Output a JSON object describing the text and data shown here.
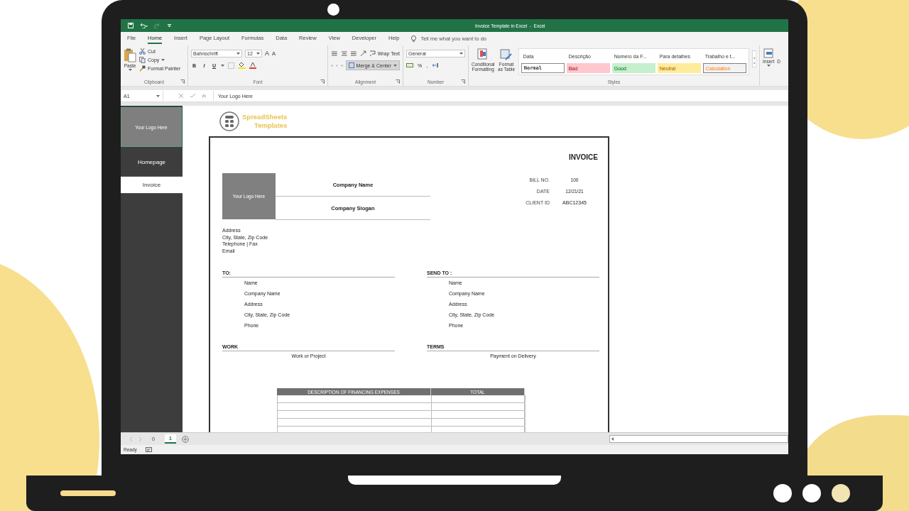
{
  "window": {
    "title": "Invoice Template in Excel  -  Excel"
  },
  "ribbon_tabs": [
    {
      "label": "File",
      "selected": false
    },
    {
      "label": "Home",
      "selected": true
    },
    {
      "label": "Insert",
      "selected": false
    },
    {
      "label": "Page Layout",
      "selected": false
    },
    {
      "label": "Formulas",
      "selected": false
    },
    {
      "label": "Data",
      "selected": false
    },
    {
      "label": "Review",
      "selected": false
    },
    {
      "label": "View",
      "selected": false
    },
    {
      "label": "Developer",
      "selected": false
    },
    {
      "label": "Help",
      "selected": false
    }
  ],
  "tell_me": {
    "placeholder": "Tell me what you want to do"
  },
  "ribbon": {
    "clipboard": {
      "label": "Clipboard",
      "paste": "Paste",
      "cut": "Cut",
      "copy": "Copy",
      "format_painter": "Format Painter"
    },
    "font": {
      "label": "Font",
      "font_name": "Bahnschrift",
      "font_size": "12",
      "size_buttons": [
        "A",
        "A"
      ],
      "style_buttons": [
        "B",
        "I",
        "U"
      ]
    },
    "alignment": {
      "label": "Alignment",
      "wrap_text": "Wrap Text",
      "merge_center": "Merge & Center"
    },
    "number": {
      "label": "Number",
      "format": "General",
      "symbols": [
        "%",
        ","
      ]
    },
    "styles": {
      "label": "Styles",
      "conditional_formatting": "Conditional Formatting",
      "format_as_table": "Format as Table",
      "gallery": [
        {
          "label": "Data",
          "kind": "heading"
        },
        {
          "label": "Descrição",
          "kind": "heading"
        },
        {
          "label": "Número da F...",
          "kind": "heading"
        },
        {
          "label": "Para detalhes",
          "kind": "heading"
        },
        {
          "label": "Trabalho e t...",
          "kind": "heading"
        },
        {
          "label": "Normal",
          "kind": "normal"
        },
        {
          "label": "Bad",
          "kind": "bad"
        },
        {
          "label": "Good",
          "kind": "good"
        },
        {
          "label": "Neutral",
          "kind": "neutral"
        },
        {
          "label": "Calculation",
          "kind": "calculation"
        }
      ]
    },
    "cells": {
      "insert": "Insert",
      "next": "D"
    }
  },
  "formula_bar": {
    "name_box": "A1",
    "function_label": "fx",
    "value": "Your Logo Here"
  },
  "sidebar": {
    "logo": "Your Logo Here",
    "items": [
      {
        "label": "Homepage",
        "selected": false
      },
      {
        "label": "Invoice",
        "selected": true
      }
    ]
  },
  "brand": {
    "line1": "SpreadSheets",
    "line2": "Templates"
  },
  "invoice": {
    "title": "INVOICE",
    "logo": "Your Logo Here",
    "company_name": "Company Name",
    "company_slogan": "Company Slogan",
    "details": [
      {
        "label": "BILL NO.",
        "value": "100"
      },
      {
        "label": "DATE",
        "value": "12/21/21"
      },
      {
        "label": "CLIENT ID",
        "value": "ABC12345"
      }
    ],
    "sender_lines": [
      "Address",
      "City, State, Zip Code",
      "Telephone | Fax",
      "Email"
    ],
    "to": {
      "heading": "TO:",
      "lines": [
        "Name",
        "Company Name",
        "Address",
        "City, State, Zip Code",
        "Phone"
      ]
    },
    "send_to": {
      "heading": "SEND TO :",
      "lines": [
        "Name",
        "Company Name",
        "Address",
        "City, State, Zip Code",
        "Phone"
      ]
    },
    "work": {
      "heading": "WORK",
      "value": "Work or Project"
    },
    "terms": {
      "heading": "TERMS",
      "value": "Payment on Delivery"
    },
    "table": {
      "columns": [
        "DESCRIPTION OF FINANCING EXPENSES",
        "TOTAL"
      ]
    }
  },
  "sheet_tabs": [
    {
      "label": "0",
      "selected": false
    },
    {
      "label": "1",
      "selected": true
    }
  ],
  "status_bar": {
    "text": "Ready"
  }
}
